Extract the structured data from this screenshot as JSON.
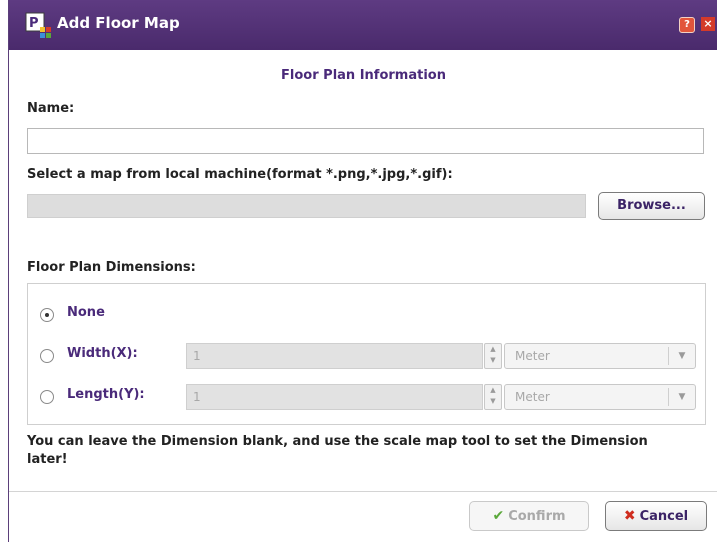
{
  "window": {
    "title": "Add Floor Map",
    "help_symbol": "?",
    "close_symbol": "×",
    "colors": {
      "titlebar": "#4a2a6c",
      "accent": "#4a2a7a"
    }
  },
  "form": {
    "section_title": "Floor Plan Information",
    "name_label": "Name:",
    "name_value": "",
    "map_label": "Select a map from local machine(format *.png,*.jpg,*.gif):",
    "map_value": "",
    "browse_label": "Browse...",
    "dimensions_label": "Floor Plan Dimensions:"
  },
  "dimensions": {
    "none_label": "None",
    "width_label": "Width(X):",
    "width_value": "1",
    "width_unit": "Meter",
    "length_label": "Length(Y):",
    "length_value": "1",
    "length_unit": "Meter",
    "selected": "none"
  },
  "note": "You can leave the Dimension blank, and use the scale map tool to set the Dimension later!",
  "buttons": {
    "confirm_label": "Confirm",
    "cancel_label": "Cancel"
  },
  "icons": {
    "app": "floor-map-app-icon",
    "help": "help-icon",
    "close": "close-icon",
    "confirm": "check-icon",
    "cancel": "x-icon"
  }
}
